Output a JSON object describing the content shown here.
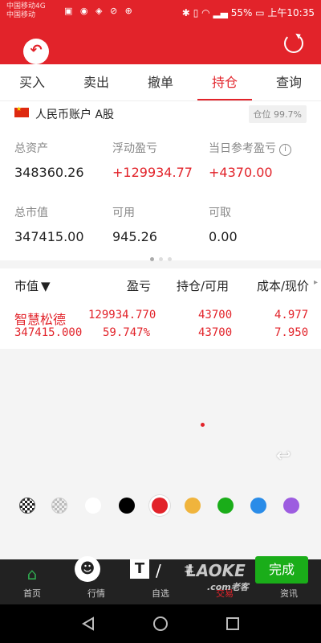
{
  "status_bar": {
    "carrier_line1": "中国移动4G",
    "carrier_line2": "中国移动",
    "battery": "55%",
    "time": "上午10:35"
  },
  "tabs": [
    "买入",
    "卖出",
    "撤单",
    "持仓",
    "查询"
  ],
  "active_tab": "持仓",
  "account": {
    "name": "人民币账户 A股",
    "position_ratio": "仓位 99.7%"
  },
  "summary": {
    "total_assets_label": "总资产",
    "total_assets": "348360.26",
    "floating_pnl_label": "浮动盈亏",
    "floating_pnl": "+129934.77",
    "today_pnl_label": "当日参考盈亏",
    "today_pnl": "+4370.00",
    "market_value_label": "总市值",
    "market_value": "347415.00",
    "available_label": "可用",
    "available": "945.26",
    "withdrawable_label": "可取",
    "withdrawable": "0.00"
  },
  "holdings": {
    "headers": [
      "市值",
      "盈亏",
      "持仓/可用",
      "成本/现价"
    ],
    "rows": [
      {
        "name": "智慧松德",
        "market_value": "347415.000",
        "pnl": "129934.770",
        "pnl_pct": "59.747%",
        "holding": "43700",
        "available": "43700",
        "cost": "4.977",
        "price": "7.950"
      }
    ]
  },
  "palette": {
    "colors": [
      "#ffffff",
      "#000000",
      "#e2232a",
      "#f0b43c",
      "#1aad19",
      "#2a8ce8",
      "#9d5ce0"
    ],
    "selected": "#e2232a"
  },
  "bottom_nav": [
    "首页",
    "行情",
    "自选",
    "交易",
    "资讯"
  ],
  "editor": {
    "done_label": "完成",
    "text_tool": "T"
  },
  "watermark": {
    "main": "LAOKE",
    "sub": ".com老客"
  }
}
